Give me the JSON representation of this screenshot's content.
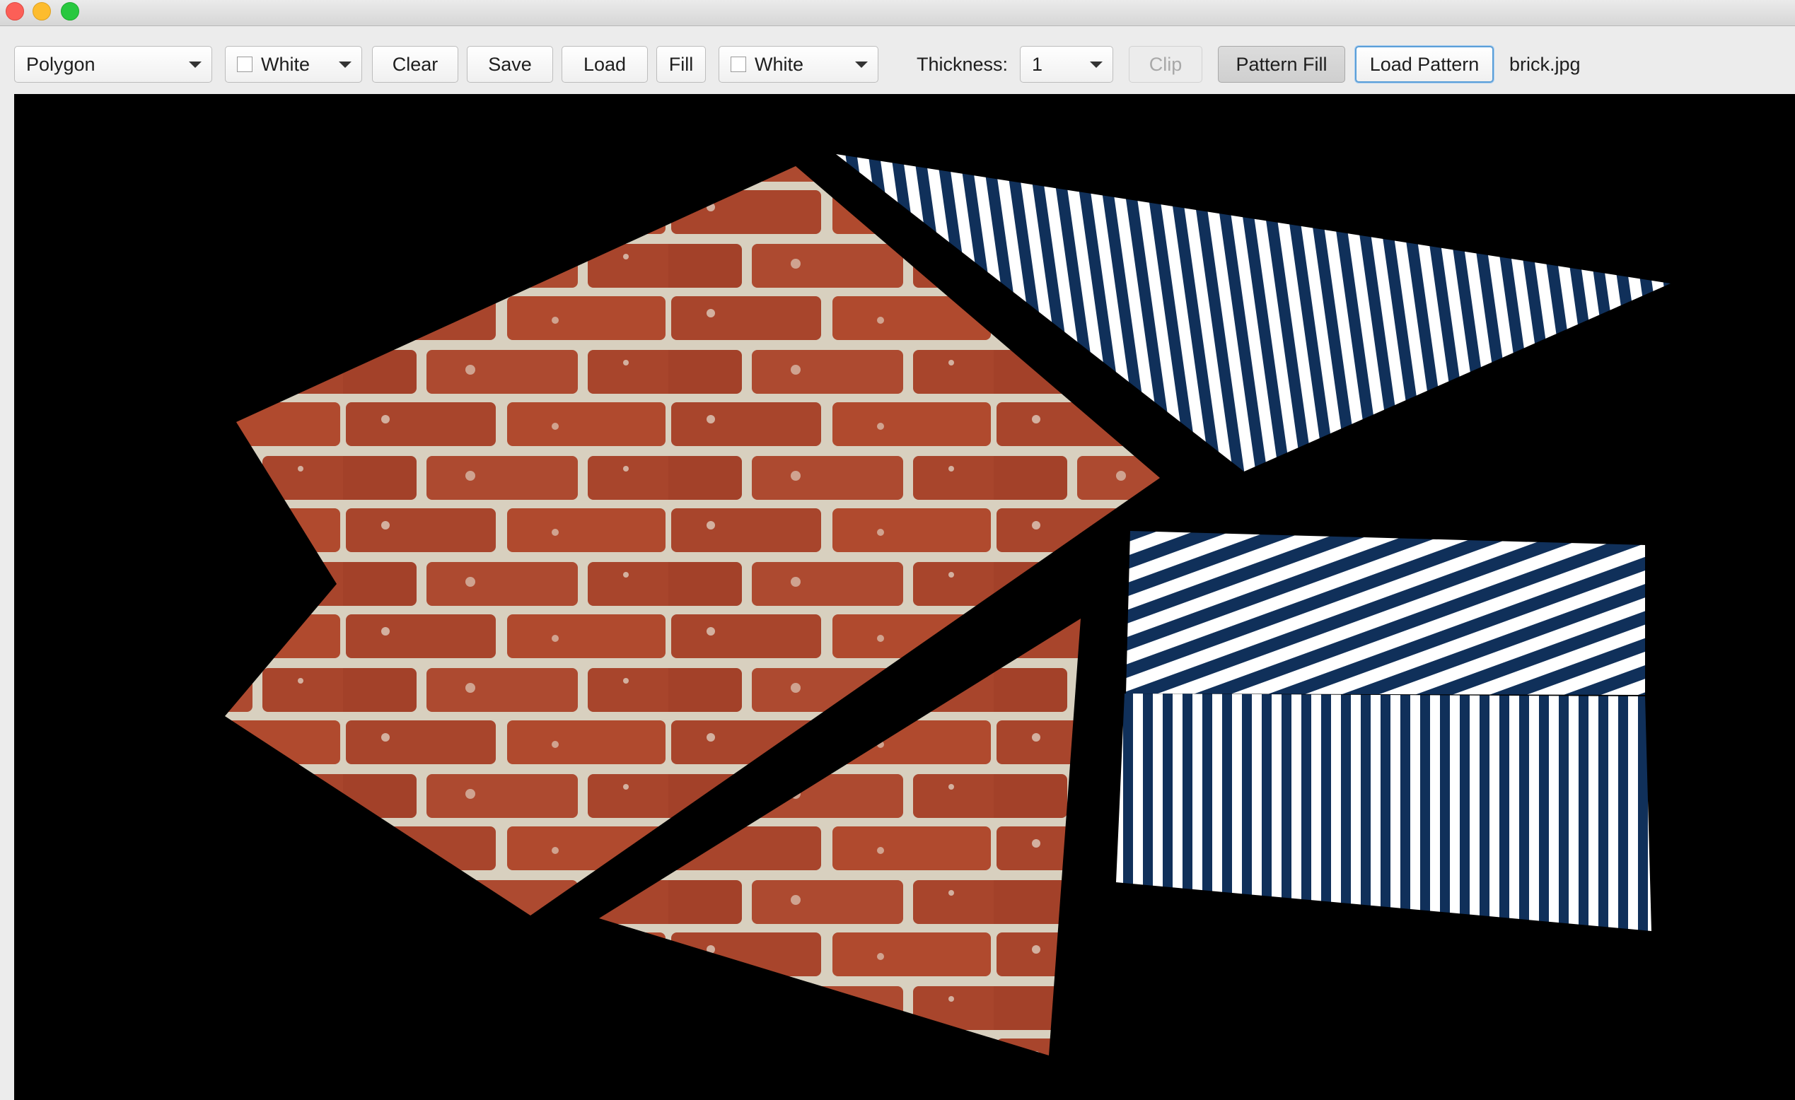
{
  "toolbar": {
    "shape_select": "Polygon",
    "color_select": "White",
    "clear_label": "Clear",
    "save_label": "Save",
    "load_label": "Load",
    "fill_label": "Fill",
    "fill_color_select": "White",
    "thickness_label": "Thickness:",
    "thickness_value": "1",
    "clip_label": "Clip",
    "pattern_fill_label": "Pattern Fill",
    "load_pattern_label": "Load Pattern",
    "pattern_file": "brick.jpg"
  },
  "colors": {
    "brick": "#a8452c",
    "mortar": "#d8d0bf",
    "stripe_navy": "#10305a",
    "stripe_white": "#ffffff",
    "canvas_bg": "#000000"
  }
}
